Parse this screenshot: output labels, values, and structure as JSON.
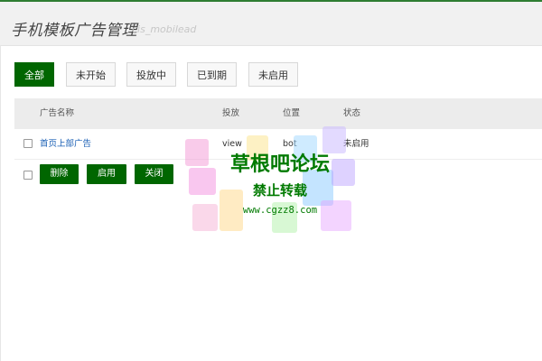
{
  "header": {
    "title": "手机模板广告管理",
    "subtitle": "cis_mobilead"
  },
  "tabs": [
    {
      "label": "全部",
      "active": true
    },
    {
      "label": "未开始",
      "active": false
    },
    {
      "label": "投放中",
      "active": false
    },
    {
      "label": "已到期",
      "active": false
    },
    {
      "label": "未启用",
      "active": false
    }
  ],
  "table": {
    "columns": [
      "广告名称",
      "投放",
      "位置",
      "状态"
    ],
    "rows": [
      {
        "name": "首页上部广告",
        "placement": "view",
        "position": "bot",
        "status": "未启用"
      }
    ]
  },
  "actions": {
    "delete_label": "删除",
    "enable_label": "启用",
    "close_label": "关闭"
  },
  "watermark": {
    "title": "草根吧论坛",
    "subtitle": "禁止转载",
    "url": "www.cgzz8.com"
  },
  "colors": {
    "accent": "#006600",
    "link": "#1a5fb4",
    "header_bg": "#f1f1f1",
    "table_head_bg": "#ececec"
  }
}
